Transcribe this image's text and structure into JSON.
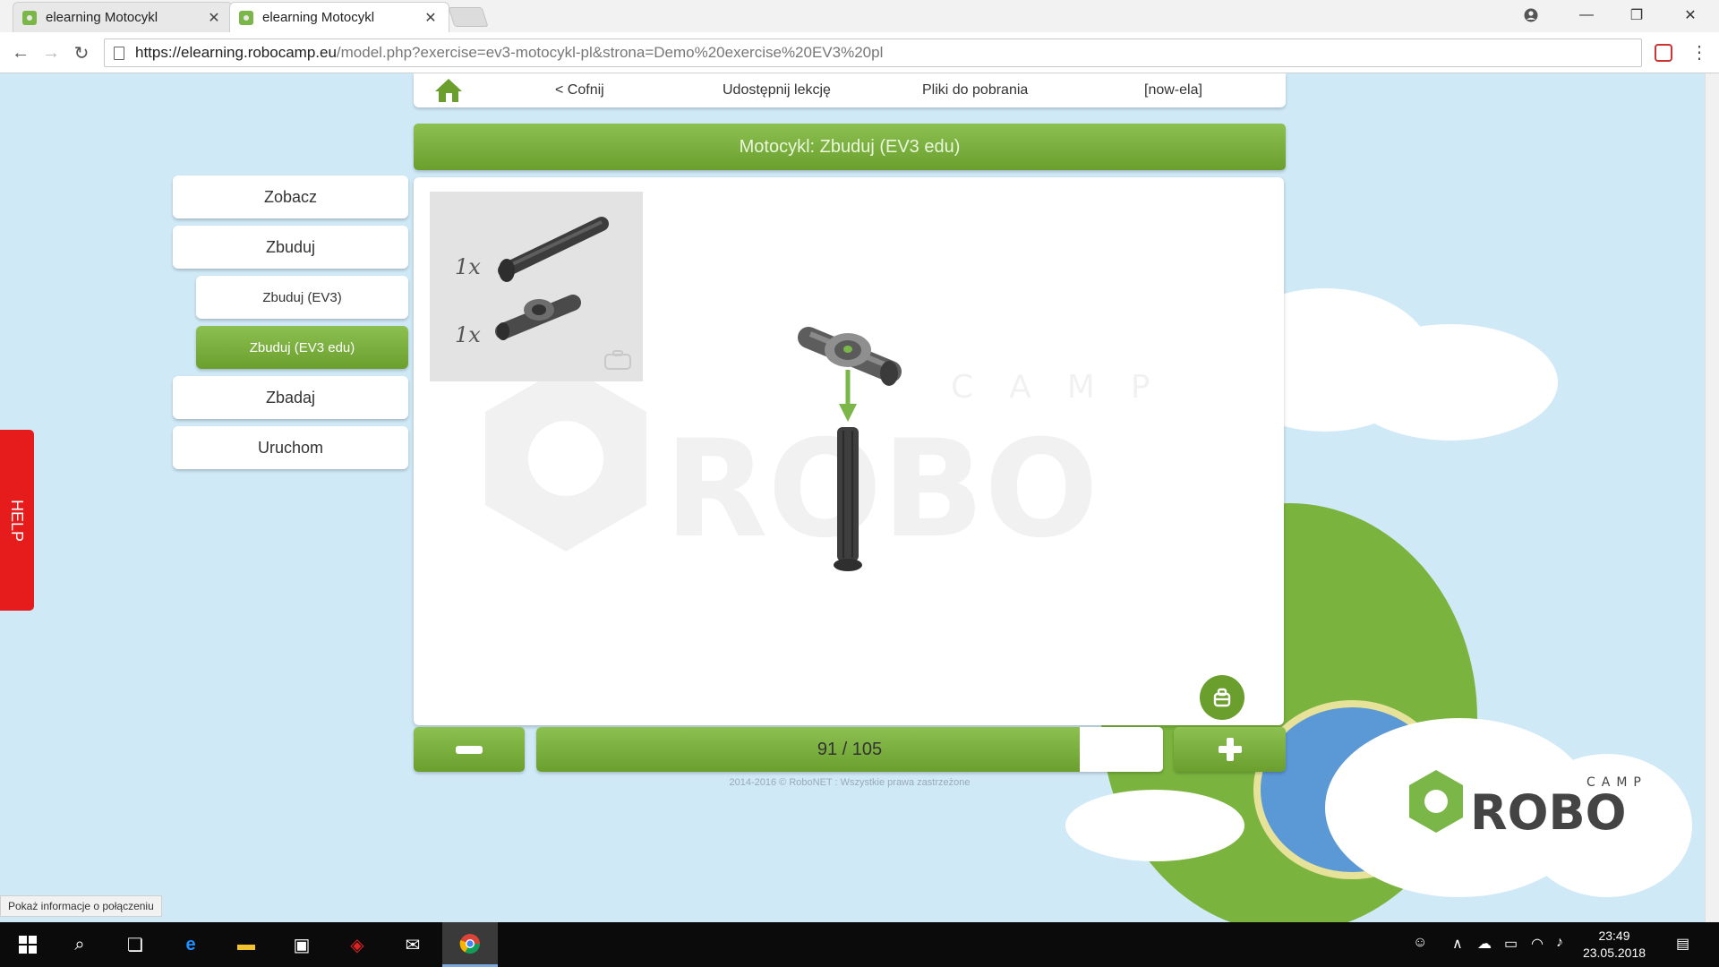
{
  "browser": {
    "tabs": [
      {
        "title": "elearning Motocykl",
        "active": false
      },
      {
        "title": "elearning Motocykl",
        "active": true
      }
    ],
    "url_host": "https://elearning.robocamp.eu",
    "url_path": "/model.php?exercise=ev3-motocykl-pl&strona=Demo%20exercise%20EV3%20pl"
  },
  "topnav": {
    "back": "< Cofnij",
    "share": "Udostępnij lekcję",
    "downloads": "Pliki do pobrania",
    "user": "[now-ela]"
  },
  "header": {
    "title": "Motocykl: Zbuduj (EV3 edu)"
  },
  "sidebar": {
    "items": [
      {
        "label": "Zobacz",
        "active": false
      },
      {
        "label": "Zbuduj",
        "active": false
      },
      {
        "label": "Zbuduj (EV3)",
        "active": false
      },
      {
        "label": "Zbuduj (EV3 edu)",
        "active": true
      },
      {
        "label": "Zbadaj",
        "active": false
      },
      {
        "label": "Uruchom",
        "active": false
      }
    ]
  },
  "parts": [
    {
      "qty": "1x",
      "icon": "axle-part-icon"
    },
    {
      "qty": "1x",
      "icon": "cross-block-part-icon"
    }
  ],
  "watermark": {
    "small": "CAMP",
    "big": "ROBO"
  },
  "progress": {
    "current": 91,
    "total": 105,
    "label": "91 / 105",
    "fraction": 0.8667
  },
  "footer": {
    "copyright": "2014-2016 © RoboNET : Wszystkie prawa zastrzeżone"
  },
  "help": {
    "label": "HELP"
  },
  "logo": {
    "small": "CAMP",
    "big": "ROBO"
  },
  "status_hint": "Pokaż informacje o połączeniu",
  "taskbar": {
    "time": "23:49",
    "date": "23.05.2018"
  },
  "colors": {
    "accent_green": "#7ab648",
    "help_red": "#e61c1c",
    "sky": "#cfe9f7"
  }
}
